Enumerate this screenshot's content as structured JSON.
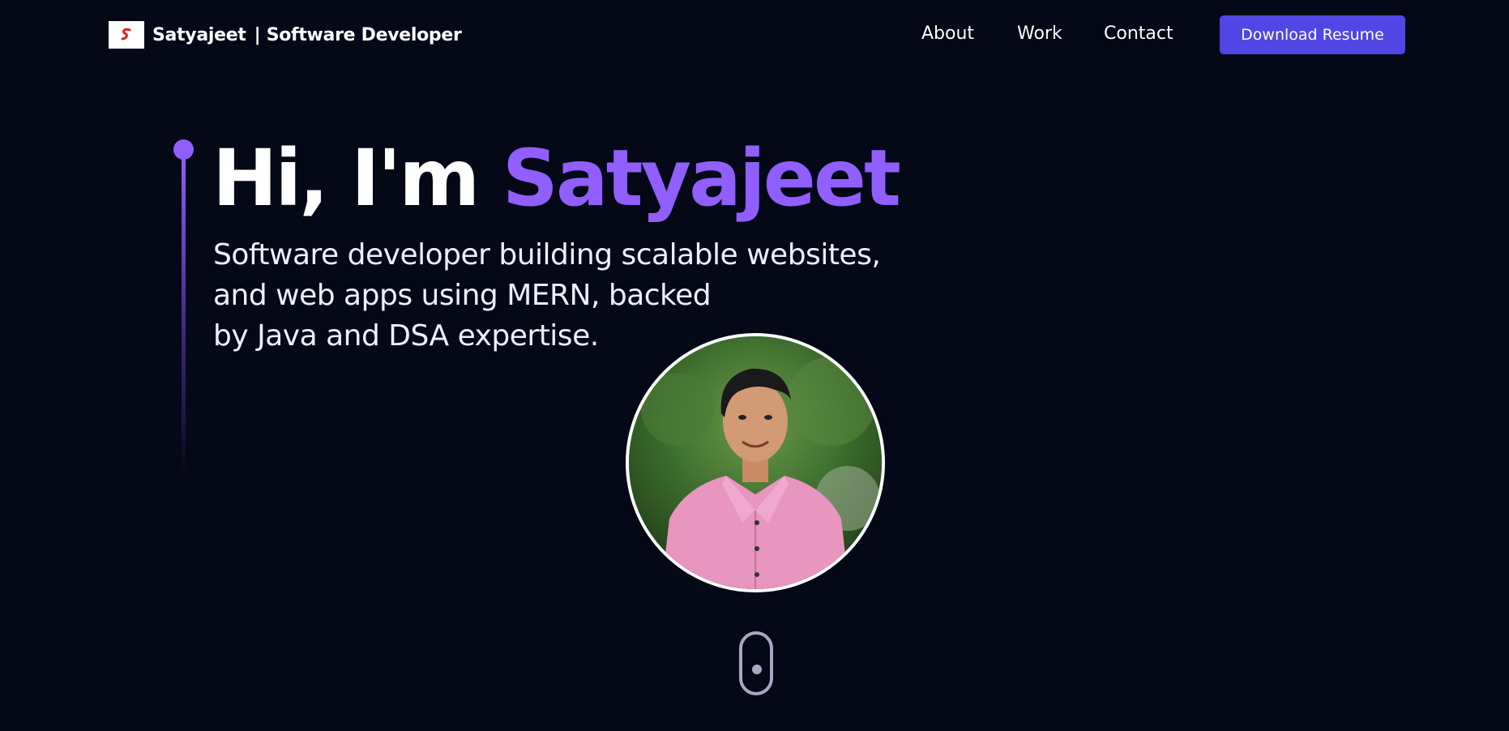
{
  "navbar": {
    "brand_name": "Satyajeet",
    "brand_role": "| Software Developer",
    "logo_letter": "S",
    "links": [
      "About",
      "Work",
      "Contact"
    ],
    "resume_label": "Download Resume"
  },
  "hero": {
    "greeting": "Hi, I'm",
    "name": "Satyajeet",
    "subtitle_lines": [
      "Software developer building scalable websites,",
      "and web apps using MERN, backed",
      "by Java and DSA expertise."
    ]
  },
  "colors": {
    "background": "#050816",
    "accent": "#915eff",
    "button": "#4f46e5",
    "scroll_indicator": "#aaa6c3"
  },
  "icons": {
    "logo": "s-logo-icon",
    "scroll": "mouse-scroll-icon"
  }
}
